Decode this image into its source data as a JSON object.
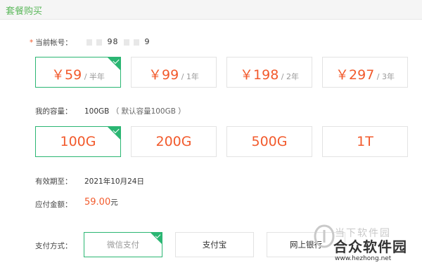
{
  "header": {
    "title": "套餐购买"
  },
  "account": {
    "label": "当前帐号：",
    "value_left": "9",
    "value_right": "9"
  },
  "plans": [
    {
      "amount": "￥59",
      "period": " / 半年",
      "selected": true
    },
    {
      "amount": "￥99",
      "period": " / 1年",
      "selected": false
    },
    {
      "amount": "￥198",
      "period": " / 2年",
      "selected": false
    },
    {
      "amount": "￥297",
      "period": " / 3年",
      "selected": false
    }
  ],
  "capacity": {
    "label": "我的容量：",
    "value": "100GB",
    "note": "（ 默认容量100GB ）",
    "options": [
      {
        "label": "100G",
        "selected": true
      },
      {
        "label": "200G",
        "selected": false
      },
      {
        "label": "500G",
        "selected": false
      },
      {
        "label": "1T",
        "selected": false
      }
    ]
  },
  "expiry": {
    "label": "有效期至：",
    "value": "2021年10月24日"
  },
  "payment_amount": {
    "label": "应付金额：",
    "value": "59.00",
    "unit": "元"
  },
  "payment_method": {
    "label": "支付方式：",
    "options": [
      {
        "label": "微信支付",
        "selected": true
      },
      {
        "label": "支付宝",
        "selected": false
      },
      {
        "label": "网上银行",
        "selected": false
      }
    ]
  },
  "watermark": {
    "top": "当下软件园",
    "main": "合众软件园",
    "url": "www.hezhong.net"
  },
  "colors": {
    "accent": "#2bb673",
    "price": "#f25a2c",
    "title": "#5cb85c"
  }
}
